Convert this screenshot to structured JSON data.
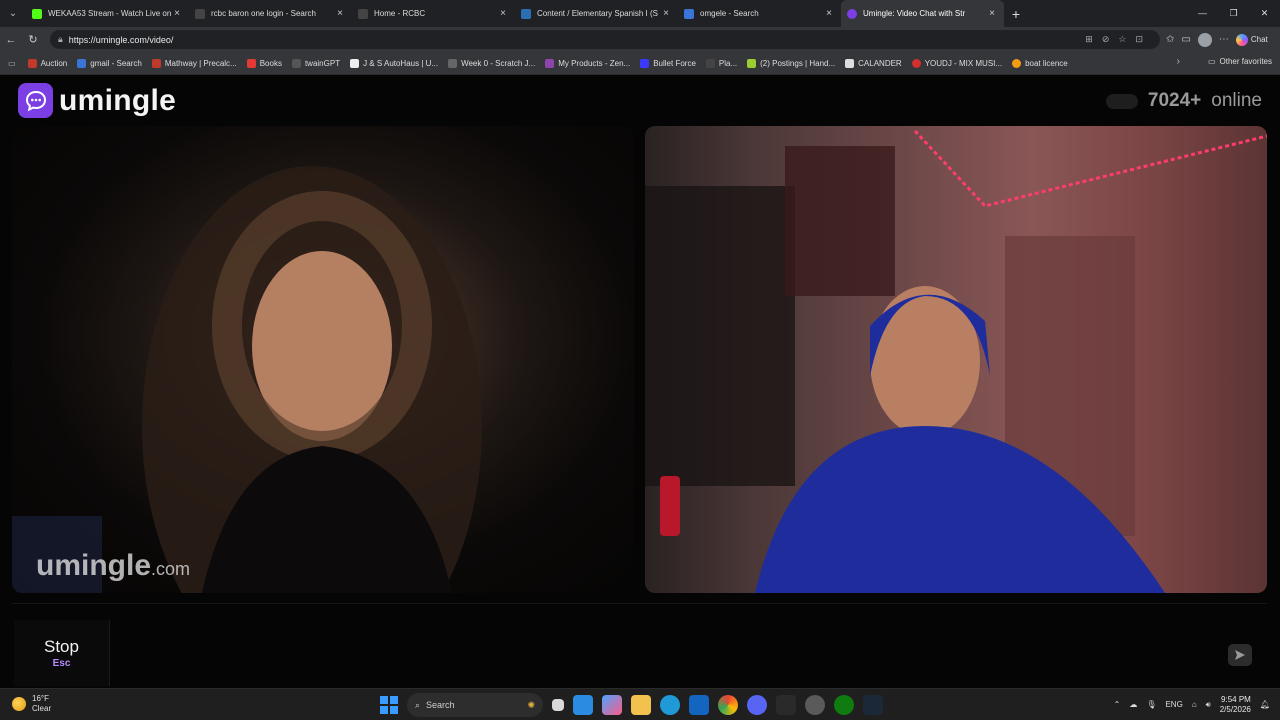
{
  "browser": {
    "tabs": [
      {
        "label": "WEKAA53 Stream - Watch Live on",
        "favicon_color": "#53fc18",
        "active": false
      },
      {
        "label": "rcbc baron one login - Search",
        "favicon_color": "#444444",
        "active": false
      },
      {
        "label": "Home - RCBC",
        "favicon_color": "#444444",
        "active": false
      },
      {
        "label": "Content / Elementary Spanish I (S",
        "favicon_color": "#2b6fb3",
        "active": false
      },
      {
        "label": "omgele - Search",
        "favicon_color": "#3a74d6",
        "active": false
      },
      {
        "label": "Umingle: Video Chat with Str",
        "favicon_color": "#e84a7a",
        "active": true
      }
    ],
    "url": "https://umingle.com/video/",
    "chat_button_label": "Chat",
    "bookmarks": [
      {
        "label": "Auction",
        "color": "#c0392b"
      },
      {
        "label": "gmail - Search",
        "color": "#3a74d6"
      },
      {
        "label": "Mathway | Precalc...",
        "color": "#c0392b"
      },
      {
        "label": "Books",
        "color": "#e53935"
      },
      {
        "label": "twainGPT",
        "color": "#555555"
      },
      {
        "label": "J & S AutoHaus | U...",
        "color": "#eeeeee"
      },
      {
        "label": "Week 0 - Scratch J...",
        "color": "#666666"
      },
      {
        "label": "My Products - Zen...",
        "color": "#8e44ad"
      },
      {
        "label": "Bullet Force",
        "color": "#3a3aff"
      },
      {
        "label": "Pla...",
        "color": "#444444"
      },
      {
        "label": "(2) Postings | Hand...",
        "color": "#9acd32"
      },
      {
        "label": "CALANDER",
        "color": "#dddddd"
      },
      {
        "label": "YOUDJ - MIX MUSI...",
        "color": "#d32f2f"
      },
      {
        "label": "boat licence",
        "color": "#f39c12"
      }
    ],
    "other_favorites_label": "Other favorites"
  },
  "page": {
    "logo_text": "umingle",
    "online_count": "7024+",
    "online_label": "online",
    "watermark_name": "umingle",
    "watermark_domain": ".com",
    "stop_label": "Stop",
    "stop_key": "Esc",
    "chat_placeholder": "",
    "accent_color": "#7b3fe4"
  },
  "taskbar": {
    "temperature": "16°F",
    "condition": "Clear",
    "search_placeholder": "Search",
    "language": "ENG",
    "time": "9:54 PM",
    "date": "2/5/2026"
  }
}
